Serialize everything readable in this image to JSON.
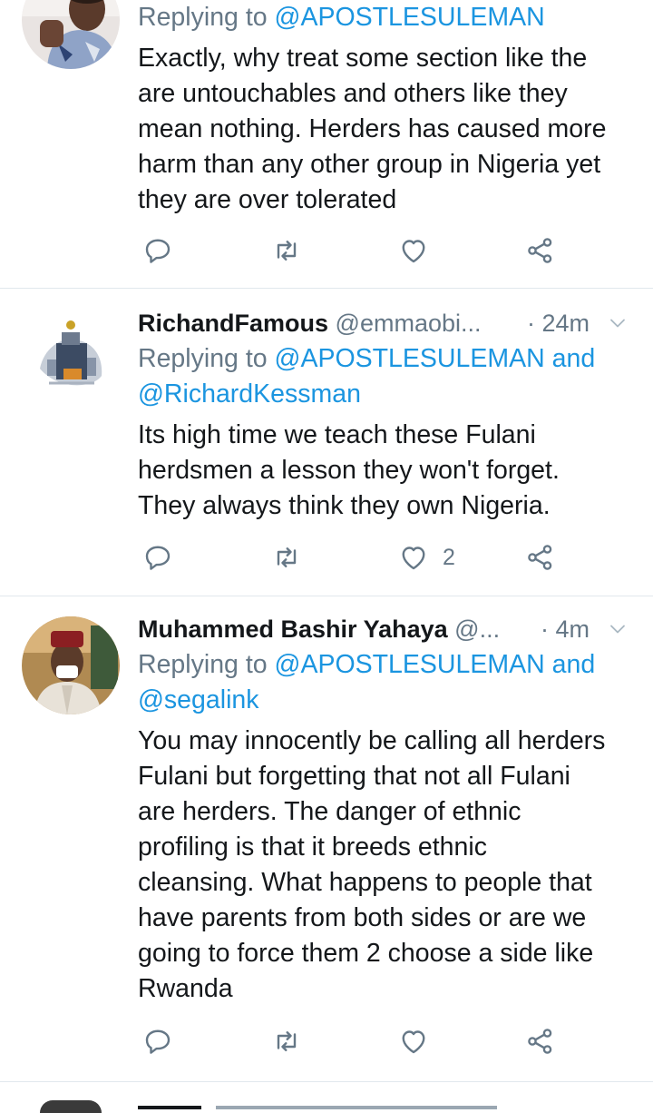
{
  "tweets": [
    {
      "replying_label": "Replying to",
      "mentions": [
        "@APOSTLESULEMAN"
      ],
      "body_lines": [
        "Exactly, why treat some section like the",
        "are untouchables and others like they",
        "mean nothing. Herders has caused more",
        "harm than any other group in Nigeria yet",
        "they are over tolerated"
      ],
      "like_count": ""
    },
    {
      "display_name": "RichandFamous",
      "handle": "@emmaobi...",
      "time": "· 24m",
      "replying_label": "Replying to",
      "mentions": [
        "@APOSTLESULEMAN",
        "and",
        "@RichardKessman"
      ],
      "body_lines": [
        "Its high time we teach these Fulani",
        "herdsmen a lesson they won't forget.",
        "They always think they own Nigeria."
      ],
      "like_count": "2"
    },
    {
      "display_name": "Muhammed Bashir Yahaya",
      "handle": "@...",
      "time": "· 4m",
      "replying_label": "Replying to",
      "mentions": [
        "@APOSTLESULEMAN",
        "and",
        "@segalink"
      ],
      "body_lines": [
        "You may innocently be calling all herders",
        "Fulani but forgetting that not all Fulani",
        "are herders. The danger of ethnic",
        "profiling is that it breeds ethnic",
        "cleansing. What happens to people that",
        "have parents from both sides or are we",
        "going to force them 2 choose a side like",
        "Rwanda"
      ],
      "like_count": ""
    }
  ],
  "icons": {
    "reply": "reply-icon",
    "retweet": "retweet-icon",
    "like": "heart-icon",
    "share": "share-icon",
    "caret": "chevron-down-icon"
  },
  "colors": {
    "link": "#1b95e0",
    "secondary": "#657786",
    "text": "#14171a",
    "divider": "#e1e8ed"
  }
}
